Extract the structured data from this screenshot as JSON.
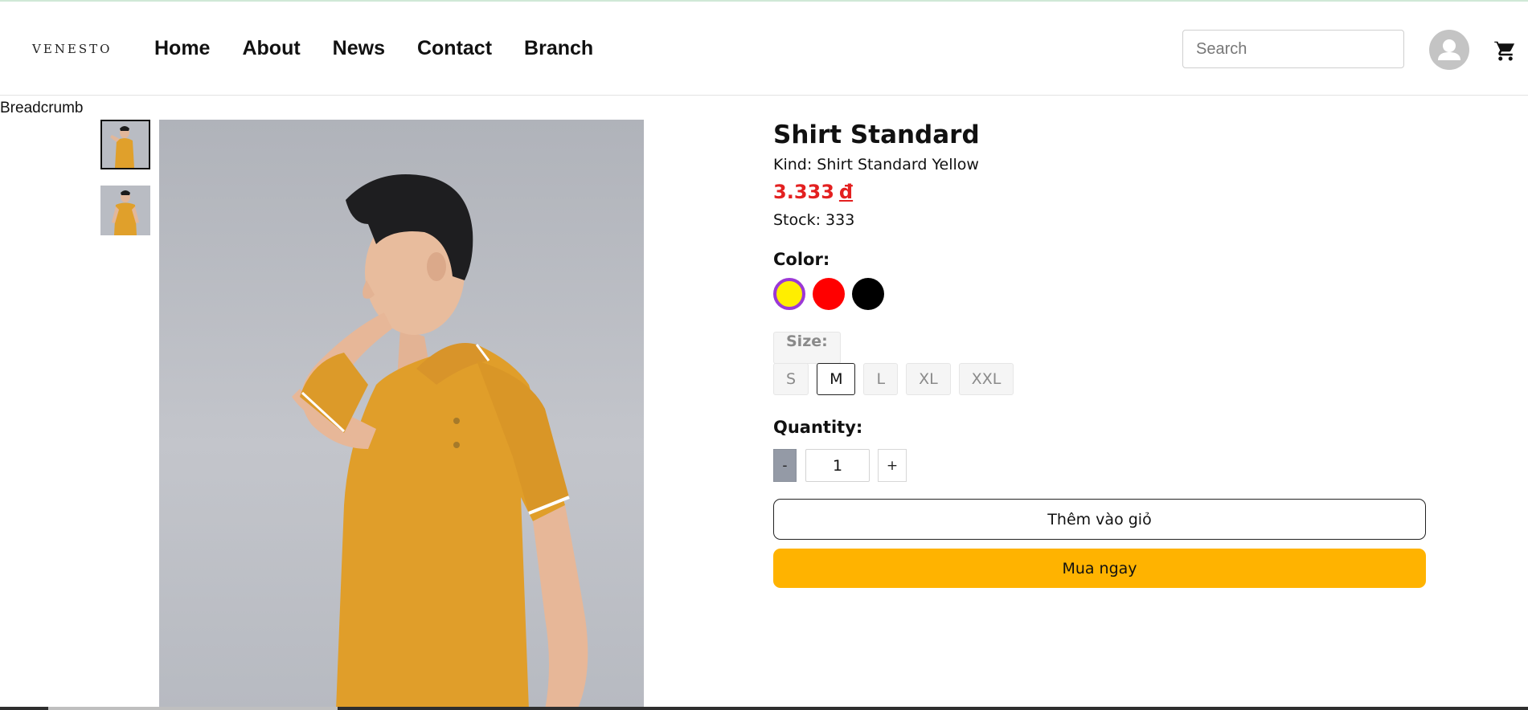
{
  "header": {
    "logo": "VENESTO",
    "nav": [
      "Home",
      "About",
      "News",
      "Contact",
      "Branch"
    ],
    "search_placeholder": "Search",
    "icons": {
      "account": "user-icon",
      "cart": "cart-icon"
    }
  },
  "breadcrumb": "Breadcrumb",
  "product": {
    "name": "Shirt Standard",
    "kind": "Kind: Shirt Standard Yellow",
    "price": "3.333",
    "currency": "đ",
    "stock": "Stock: 333",
    "color_label": "Color:",
    "colors": [
      {
        "name": "yellow",
        "hex": "#ffee00",
        "selected": true
      },
      {
        "name": "red",
        "hex": "#ff0000",
        "selected": false
      },
      {
        "name": "black",
        "hex": "#000000",
        "selected": false
      }
    ],
    "size_label": "Size:",
    "sizes": [
      "S",
      "M",
      "L",
      "XL",
      "XXL"
    ],
    "selected_size": "M",
    "quantity_label": "Quantity:",
    "quantity": "1",
    "minus": "-",
    "plus": "+",
    "add_to_cart": "Thêm vào giỏ",
    "buy_now": "Mua ngay"
  },
  "colors": {
    "price": "#e32020",
    "buy_button": "#ffb300",
    "selected_swatch_border": "#9b38d6"
  }
}
